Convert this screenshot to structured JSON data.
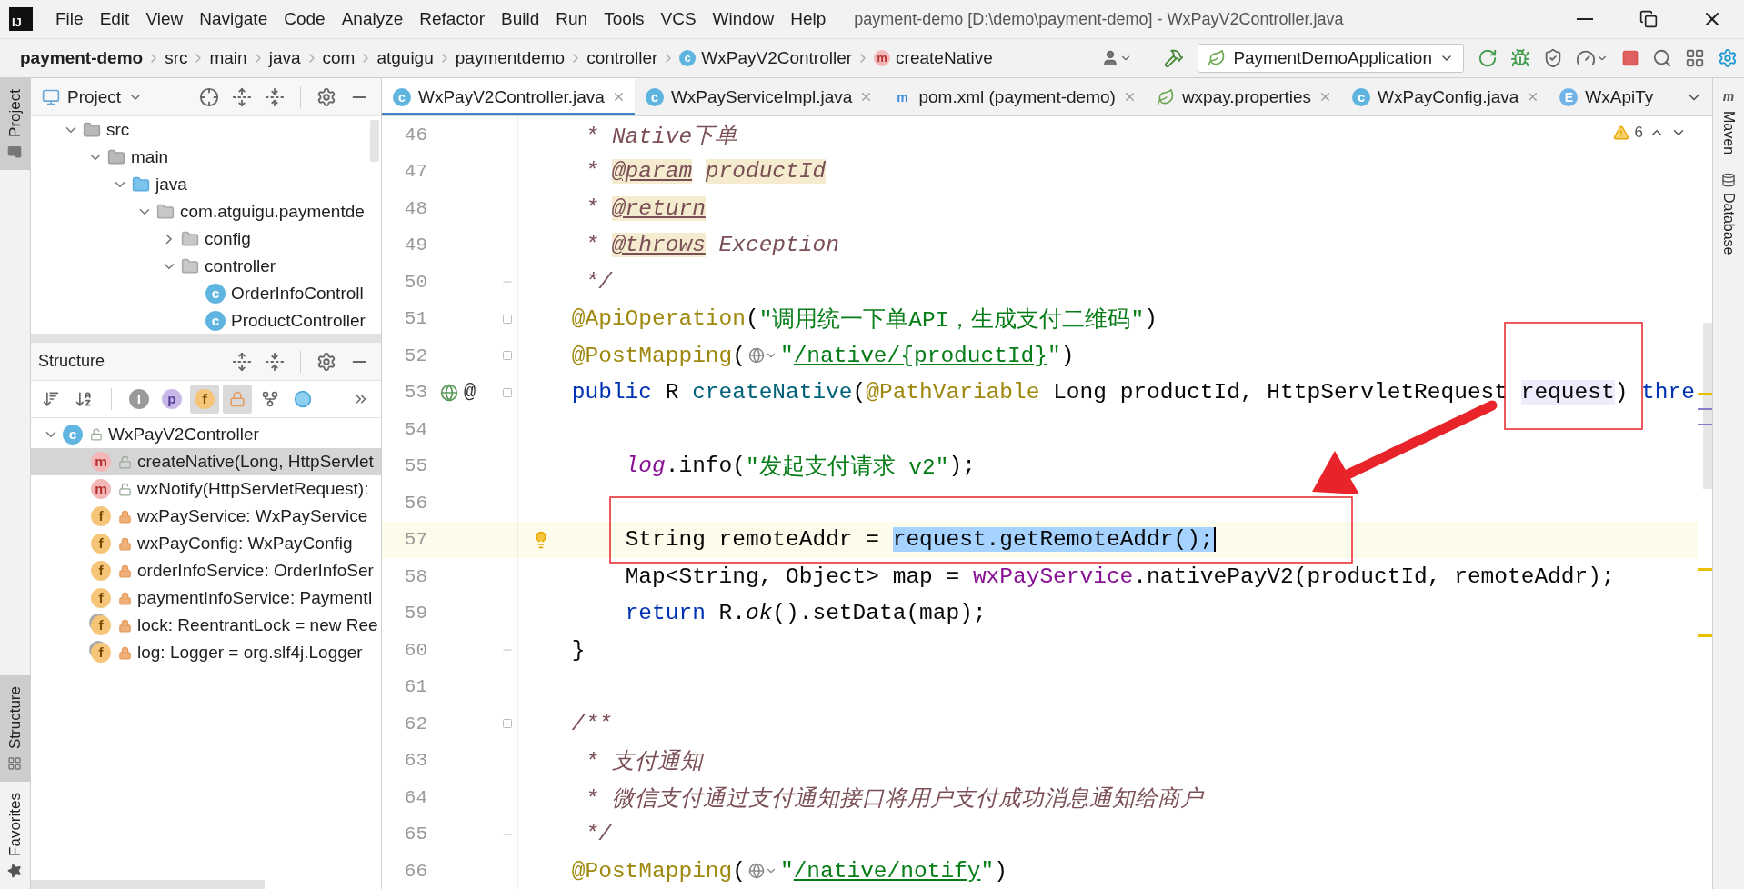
{
  "window": {
    "logo": "IJ",
    "title": "payment-demo [D:\\demo\\payment-demo] - WxPayV2Controller.java"
  },
  "menu": [
    "File",
    "Edit",
    "View",
    "Navigate",
    "Code",
    "Analyze",
    "Refactor",
    "Build",
    "Run",
    "Tools",
    "VCS",
    "Window",
    "Help"
  ],
  "breadcrumbs": [
    {
      "label": "payment-demo",
      "kind": "project"
    },
    {
      "label": "src",
      "kind": "folder"
    },
    {
      "label": "main",
      "kind": "folder"
    },
    {
      "label": "java",
      "kind": "folder"
    },
    {
      "label": "com",
      "kind": "folder"
    },
    {
      "label": "atguigu",
      "kind": "folder"
    },
    {
      "label": "paymentdemo",
      "kind": "folder"
    },
    {
      "label": "controller",
      "kind": "folder"
    },
    {
      "label": "WxPayV2Controller",
      "kind": "class",
      "icon_letter": "c"
    },
    {
      "label": "createNative",
      "kind": "method",
      "icon_letter": "m"
    }
  ],
  "run_config": {
    "label": "PaymentDemoApplication"
  },
  "left_stripe": [
    {
      "label": "Project",
      "kind": "project",
      "selected": true
    },
    {
      "label": "Structure",
      "kind": "structure",
      "selected": true
    },
    {
      "label": "Favorites",
      "kind": "favorites",
      "selected": false
    }
  ],
  "project_panel": {
    "title": "Project",
    "tree": [
      {
        "label": "src",
        "kind": "folder",
        "expanded": true,
        "children": [
          {
            "label": "main",
            "kind": "folder",
            "expanded": true,
            "children": [
              {
                "label": "java",
                "kind": "source",
                "expanded": true,
                "children": [
                  {
                    "label": "com.atguigu.paymentde",
                    "kind": "package",
                    "expanded": true,
                    "children": [
                      {
                        "label": "config",
                        "kind": "package",
                        "expanded": false
                      },
                      {
                        "label": "controller",
                        "kind": "package",
                        "expanded": true,
                        "children": [
                          {
                            "label": "OrderInfoControll",
                            "kind": "class",
                            "icon_letter": "c"
                          },
                          {
                            "label": "ProductController",
                            "kind": "class",
                            "icon_letter": "c"
                          }
                        ]
                      }
                    ]
                  }
                ]
              }
            ]
          }
        ]
      }
    ]
  },
  "structure_panel": {
    "title": "Structure",
    "toolbar": [
      {
        "kind": "sort-visibility",
        "on": false
      },
      {
        "kind": "sort-alpha",
        "on": false
      },
      {
        "kind": "letter",
        "letter": "I",
        "on": false
      },
      {
        "kind": "letter",
        "letter": "p",
        "on": false
      },
      {
        "kind": "letter",
        "letter": "f",
        "on": true
      },
      {
        "kind": "lock",
        "on": true
      },
      {
        "kind": "fork",
        "on": false
      },
      {
        "kind": "circle",
        "on": false
      }
    ],
    "root": {
      "label": "WxPayV2Controller",
      "icon_letter": "c",
      "expanded": true
    },
    "items": [
      {
        "label": "createNative(Long, HttpServlet",
        "icon_letter": "m",
        "kind": "method",
        "static": false,
        "selected": true
      },
      {
        "label": "wxNotify(HttpServletRequest):",
        "icon_letter": "m",
        "kind": "method",
        "static": false,
        "selected": false
      },
      {
        "label": "wxPayService: WxPayService",
        "icon_letter": "f",
        "kind": "field",
        "static": false,
        "selected": false
      },
      {
        "label": "wxPayConfig: WxPayConfig",
        "icon_letter": "f",
        "kind": "field",
        "static": false,
        "selected": false
      },
      {
        "label": "orderInfoService: OrderInfoSer",
        "icon_letter": "f",
        "kind": "field",
        "static": false,
        "selected": false
      },
      {
        "label": "paymentInfoService: PaymentI",
        "icon_letter": "f",
        "kind": "field",
        "static": false,
        "selected": false
      },
      {
        "label": "lock: ReentrantLock = new Ree",
        "icon_letter": "f",
        "kind": "field",
        "static": true,
        "selected": false
      },
      {
        "label": "log: Logger = org.slf4j.Logger",
        "icon_letter": "f",
        "kind": "field",
        "static": true,
        "selected": false
      }
    ]
  },
  "editor": {
    "tabs": [
      {
        "label": "WxPayV2Controller.java",
        "icon_letter": "c",
        "kind": "class",
        "selected": true,
        "closable": true
      },
      {
        "label": "WxPayServiceImpl.java",
        "icon_letter": "c",
        "kind": "class",
        "selected": false,
        "closable": true
      },
      {
        "label": "pom.xml (payment-demo)",
        "icon_letter": "m",
        "kind": "maven",
        "selected": false,
        "closable": true
      },
      {
        "label": "wxpay.properties",
        "kind": "properties",
        "selected": false,
        "closable": true
      },
      {
        "label": "WxPayConfig.java",
        "icon_letter": "c",
        "kind": "class",
        "selected": false,
        "closable": true
      },
      {
        "label": "WxApiTy",
        "icon_letter": "E",
        "kind": "enum",
        "selected": false,
        "closable": false
      }
    ],
    "warnings": "6",
    "lines": [
      {
        "number": "46",
        "tokens": [
          {
            "kind": "doc",
            "text": "     * Native下单"
          }
        ]
      },
      {
        "number": "47",
        "tokens": [
          {
            "kind": "doc",
            "text": "     * "
          },
          {
            "kind": "doctag",
            "text": "@param"
          },
          {
            "kind": "docref",
            "text": " productId"
          }
        ]
      },
      {
        "number": "48",
        "tokens": [
          {
            "kind": "doc",
            "text": "     * "
          },
          {
            "kind": "doctag",
            "text": "@return"
          }
        ]
      },
      {
        "number": "49",
        "tokens": [
          {
            "kind": "doc",
            "text": "     * "
          },
          {
            "kind": "doctag",
            "text": "@throws"
          },
          {
            "kind": "doc",
            "text": " Exception"
          }
        ]
      },
      {
        "number": "50",
        "fold_close": true,
        "tokens": [
          {
            "kind": "doc",
            "text": "     */"
          }
        ]
      },
      {
        "number": "51",
        "fold_open": true,
        "tokens": [
          {
            "kind": "annotation",
            "text": "    @ApiOperation"
          },
          {
            "kind": "plain",
            "text": "("
          },
          {
            "kind": "string",
            "text": "\"调用统一下单API，生成支付二维码\""
          },
          {
            "kind": "plain",
            "text": ")"
          }
        ]
      },
      {
        "number": "52",
        "fold_open": true,
        "tokens": [
          {
            "kind": "annotation",
            "text": "    @PostMapping"
          },
          {
            "kind": "plain",
            "text": "("
          },
          {
            "kind": "inlay"
          },
          {
            "kind": "string",
            "text": "\""
          },
          {
            "kind": "link",
            "text": "/native/{productId}"
          },
          {
            "kind": "string",
            "text": "\""
          },
          {
            "kind": "plain",
            "text": ")"
          }
        ]
      },
      {
        "number": "53",
        "fold_open": true,
        "endpoint": true,
        "gutter_mark": "@",
        "tokens": [
          {
            "kind": "keyword",
            "text": "    public"
          },
          {
            "kind": "plain",
            "text": " R "
          },
          {
            "kind": "method",
            "text": "createNative"
          },
          {
            "kind": "plain",
            "text": "("
          },
          {
            "kind": "annotation",
            "text": "@PathVariable"
          },
          {
            "kind": "plain",
            "text": " Long productId, HttpServletRequest "
          },
          {
            "kind": "usage",
            "text": "request"
          },
          {
            "kind": "plain",
            "text": ") "
          },
          {
            "kind": "keyword",
            "text": "thre"
          }
        ]
      },
      {
        "number": "54"
      },
      {
        "number": "55",
        "tokens": [
          {
            "kind": "static-field",
            "text": "        log"
          },
          {
            "kind": "plain",
            "text": ".info("
          },
          {
            "kind": "string",
            "text": "\"发起支付请求 v2\""
          },
          {
            "kind": "plain",
            "text": ");"
          }
        ]
      },
      {
        "number": "56"
      },
      {
        "number": "57",
        "current": true,
        "bulb": true,
        "tokens": [
          {
            "kind": "plain",
            "text": "        String remoteAddr = "
          },
          {
            "kind": "selected",
            "text": "request.getRemoteAddr();"
          }
        ]
      },
      {
        "number": "58",
        "tokens": [
          {
            "kind": "plain",
            "text": "        Map<String, Object> map = "
          },
          {
            "kind": "field",
            "text": "wxPayService"
          },
          {
            "kind": "plain",
            "text": ".nativePayV2(productId, remoteAddr);"
          }
        ]
      },
      {
        "number": "59",
        "tokens": [
          {
            "kind": "keyword",
            "text": "        return"
          },
          {
            "kind": "plain",
            "text": " R."
          },
          {
            "kind": "static-method",
            "text": "ok"
          },
          {
            "kind": "plain",
            "text": "().setData(map);"
          }
        ]
      },
      {
        "number": "60",
        "fold_close": true,
        "tokens": [
          {
            "kind": "plain",
            "text": "    }"
          }
        ]
      },
      {
        "number": "61"
      },
      {
        "number": "62",
        "fold_open": true,
        "tokens": [
          {
            "kind": "doc",
            "text": "    /**"
          }
        ]
      },
      {
        "number": "63",
        "tokens": [
          {
            "kind": "doc",
            "text": "     * 支付通知"
          }
        ]
      },
      {
        "number": "64",
        "tokens": [
          {
            "kind": "doc",
            "text": "     * 微信支付通过支付通知接口将用户支付成功消息通知给商户"
          }
        ]
      },
      {
        "number": "65",
        "fold_close": true,
        "tokens": [
          {
            "kind": "doc",
            "text": "     */"
          }
        ]
      },
      {
        "number": "66",
        "tokens": [
          {
            "kind": "annotation",
            "text": "    @PostMapping"
          },
          {
            "kind": "plain",
            "text": "("
          },
          {
            "kind": "inlay"
          },
          {
            "kind": "string",
            "text": "\""
          },
          {
            "kind": "link",
            "text": "/native/notify"
          },
          {
            "kind": "string",
            "text": "\""
          },
          {
            "kind": "plain",
            "text": ")"
          }
        ]
      }
    ]
  },
  "right_stripe": [
    {
      "label": "Maven",
      "kind": "maven",
      "icon_letter": "m"
    },
    {
      "label": "Database",
      "kind": "database"
    }
  ]
}
